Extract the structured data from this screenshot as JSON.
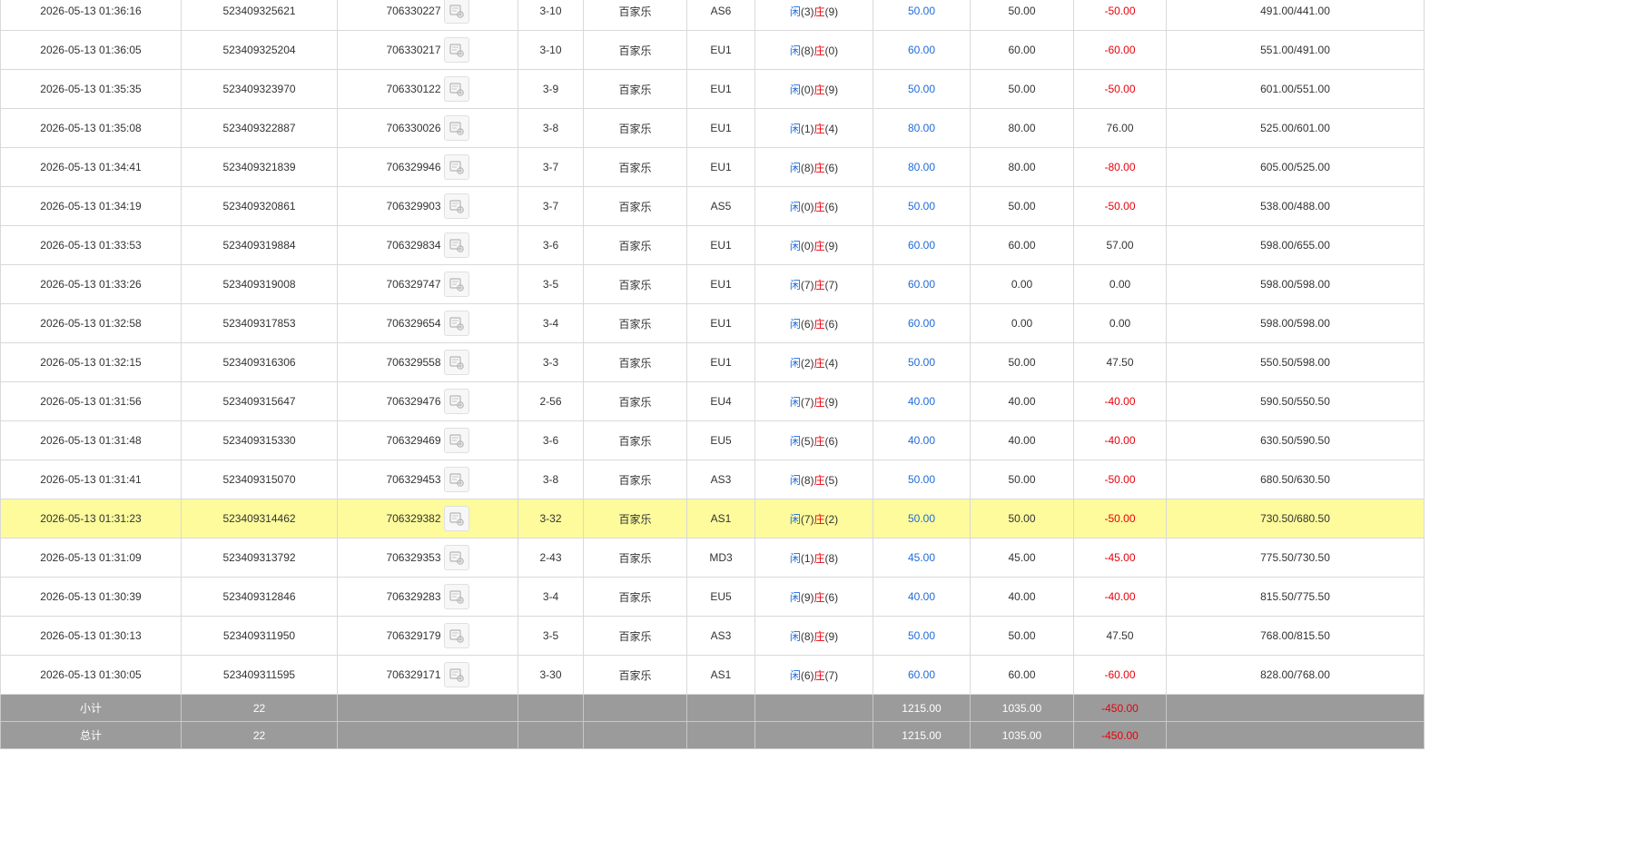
{
  "rows": [
    {
      "time": "2026-05-13 01:36:16",
      "order_no": "523409325621",
      "game_no": "706330227",
      "round": "3-10",
      "game": "百家乐",
      "table": "AS6",
      "result": {
        "p_label": "闲",
        "p": "(3)",
        "b_label": "庄",
        "b": "(9)"
      },
      "bet": "50.00",
      "valid": "50.00",
      "win": "-50.00",
      "win_neg": true,
      "balance": "491.00/441.00",
      "highlight": false
    },
    {
      "time": "2026-05-13 01:36:05",
      "order_no": "523409325204",
      "game_no": "706330217",
      "round": "3-10",
      "game": "百家乐",
      "table": "EU1",
      "result": {
        "p_label": "闲",
        "p": "(8)",
        "b_label": "庄",
        "b": "(0)"
      },
      "bet": "60.00",
      "valid": "60.00",
      "win": "-60.00",
      "win_neg": true,
      "balance": "551.00/491.00",
      "highlight": false
    },
    {
      "time": "2026-05-13 01:35:35",
      "order_no": "523409323970",
      "game_no": "706330122",
      "round": "3-9",
      "game": "百家乐",
      "table": "EU1",
      "result": {
        "p_label": "闲",
        "p": "(0)",
        "b_label": "庄",
        "b": "(9)"
      },
      "bet": "50.00",
      "valid": "50.00",
      "win": "-50.00",
      "win_neg": true,
      "balance": "601.00/551.00",
      "highlight": false
    },
    {
      "time": "2026-05-13 01:35:08",
      "order_no": "523409322887",
      "game_no": "706330026",
      "round": "3-8",
      "game": "百家乐",
      "table": "EU1",
      "result": {
        "p_label": "闲",
        "p": "(1)",
        "b_label": "庄",
        "b": "(4)"
      },
      "bet": "80.00",
      "valid": "80.00",
      "win": "76.00",
      "win_neg": false,
      "balance": "525.00/601.00",
      "highlight": false
    },
    {
      "time": "2026-05-13 01:34:41",
      "order_no": "523409321839",
      "game_no": "706329946",
      "round": "3-7",
      "game": "百家乐",
      "table": "EU1",
      "result": {
        "p_label": "闲",
        "p": "(8)",
        "b_label": "庄",
        "b": "(6)"
      },
      "bet": "80.00",
      "valid": "80.00",
      "win": "-80.00",
      "win_neg": true,
      "balance": "605.00/525.00",
      "highlight": false
    },
    {
      "time": "2026-05-13 01:34:19",
      "order_no": "523409320861",
      "game_no": "706329903",
      "round": "3-7",
      "game": "百家乐",
      "table": "AS5",
      "result": {
        "p_label": "闲",
        "p": "(0)",
        "b_label": "庄",
        "b": "(6)"
      },
      "bet": "50.00",
      "valid": "50.00",
      "win": "-50.00",
      "win_neg": true,
      "balance": "538.00/488.00",
      "highlight": false
    },
    {
      "time": "2026-05-13 01:33:53",
      "order_no": "523409319884",
      "game_no": "706329834",
      "round": "3-6",
      "game": "百家乐",
      "table": "EU1",
      "result": {
        "p_label": "闲",
        "p": "(0)",
        "b_label": "庄",
        "b": "(9)"
      },
      "bet": "60.00",
      "valid": "60.00",
      "win": "57.00",
      "win_neg": false,
      "balance": "598.00/655.00",
      "highlight": false
    },
    {
      "time": "2026-05-13 01:33:26",
      "order_no": "523409319008",
      "game_no": "706329747",
      "round": "3-5",
      "game": "百家乐",
      "table": "EU1",
      "result": {
        "p_label": "闲",
        "p": "(7)",
        "b_label": "庄",
        "b": "(7)"
      },
      "bet": "60.00",
      "valid": "0.00",
      "win": "0.00",
      "win_neg": false,
      "balance": "598.00/598.00",
      "highlight": false
    },
    {
      "time": "2026-05-13 01:32:58",
      "order_no": "523409317853",
      "game_no": "706329654",
      "round": "3-4",
      "game": "百家乐",
      "table": "EU1",
      "result": {
        "p_label": "闲",
        "p": "(6)",
        "b_label": "庄",
        "b": "(6)"
      },
      "bet": "60.00",
      "valid": "0.00",
      "win": "0.00",
      "win_neg": false,
      "balance": "598.00/598.00",
      "highlight": false
    },
    {
      "time": "2026-05-13 01:32:15",
      "order_no": "523409316306",
      "game_no": "706329558",
      "round": "3-3",
      "game": "百家乐",
      "table": "EU1",
      "result": {
        "p_label": "闲",
        "p": "(2)",
        "b_label": "庄",
        "b": "(4)"
      },
      "bet": "50.00",
      "valid": "50.00",
      "win": "47.50",
      "win_neg": false,
      "balance": "550.50/598.00",
      "highlight": false
    },
    {
      "time": "2026-05-13 01:31:56",
      "order_no": "523409315647",
      "game_no": "706329476",
      "round": "2-56",
      "game": "百家乐",
      "table": "EU4",
      "result": {
        "p_label": "闲",
        "p": "(7)",
        "b_label": "庄",
        "b": "(9)"
      },
      "bet": "40.00",
      "valid": "40.00",
      "win": "-40.00",
      "win_neg": true,
      "balance": "590.50/550.50",
      "highlight": false
    },
    {
      "time": "2026-05-13 01:31:48",
      "order_no": "523409315330",
      "game_no": "706329469",
      "round": "3-6",
      "game": "百家乐",
      "table": "EU5",
      "result": {
        "p_label": "闲",
        "p": "(5)",
        "b_label": "庄",
        "b": "(6)"
      },
      "bet": "40.00",
      "valid": "40.00",
      "win": "-40.00",
      "win_neg": true,
      "balance": "630.50/590.50",
      "highlight": false
    },
    {
      "time": "2026-05-13 01:31:41",
      "order_no": "523409315070",
      "game_no": "706329453",
      "round": "3-8",
      "game": "百家乐",
      "table": "AS3",
      "result": {
        "p_label": "闲",
        "p": "(8)",
        "b_label": "庄",
        "b": "(5)"
      },
      "bet": "50.00",
      "valid": "50.00",
      "win": "-50.00",
      "win_neg": true,
      "balance": "680.50/630.50",
      "highlight": false
    },
    {
      "time": "2026-05-13 01:31:23",
      "order_no": "523409314462",
      "game_no": "706329382",
      "round": "3-32",
      "game": "百家乐",
      "table": "AS1",
      "result": {
        "p_label": "闲",
        "p": "(7)",
        "b_label": "庄",
        "b": "(2)"
      },
      "bet": "50.00",
      "valid": "50.00",
      "win": "-50.00",
      "win_neg": true,
      "balance": "730.50/680.50",
      "highlight": true
    },
    {
      "time": "2026-05-13 01:31:09",
      "order_no": "523409313792",
      "game_no": "706329353",
      "round": "2-43",
      "game": "百家乐",
      "table": "MD3",
      "result": {
        "p_label": "闲",
        "p": "(1)",
        "b_label": "庄",
        "b": "(8)"
      },
      "bet": "45.00",
      "valid": "45.00",
      "win": "-45.00",
      "win_neg": true,
      "balance": "775.50/730.50",
      "highlight": false
    },
    {
      "time": "2026-05-13 01:30:39",
      "order_no": "523409312846",
      "game_no": "706329283",
      "round": "3-4",
      "game": "百家乐",
      "table": "EU5",
      "result": {
        "p_label": "闲",
        "p": "(9)",
        "b_label": "庄",
        "b": "(6)"
      },
      "bet": "40.00",
      "valid": "40.00",
      "win": "-40.00",
      "win_neg": true,
      "balance": "815.50/775.50",
      "highlight": false
    },
    {
      "time": "2026-05-13 01:30:13",
      "order_no": "523409311950",
      "game_no": "706329179",
      "round": "3-5",
      "game": "百家乐",
      "table": "AS3",
      "result": {
        "p_label": "闲",
        "p": "(8)",
        "b_label": "庄",
        "b": "(9)"
      },
      "bet": "50.00",
      "valid": "50.00",
      "win": "47.50",
      "win_neg": false,
      "balance": "768.00/815.50",
      "highlight": false
    },
    {
      "time": "2026-05-13 01:30:05",
      "order_no": "523409311595",
      "game_no": "706329171",
      "round": "3-30",
      "game": "百家乐",
      "table": "AS1",
      "result": {
        "p_label": "闲",
        "p": "(6)",
        "b_label": "庄",
        "b": "(7)"
      },
      "bet": "60.00",
      "valid": "60.00",
      "win": "-60.00",
      "win_neg": true,
      "balance": "828.00/768.00",
      "highlight": false
    }
  ],
  "subtotal": {
    "label": "小计",
    "count": "22",
    "bet": "1215.00",
    "valid": "1035.00",
    "win": "-450.00"
  },
  "total": {
    "label": "总计",
    "count": "22",
    "bet": "1215.00",
    "valid": "1035.00",
    "win": "-450.00"
  },
  "icons": {
    "detail": "game-detail-icon"
  },
  "colors": {
    "negative": "#e8000b",
    "bet_blue": "#1f6ad8",
    "highlight_row": "#fdfb9c",
    "summary_bg": "#9b9b9b"
  }
}
